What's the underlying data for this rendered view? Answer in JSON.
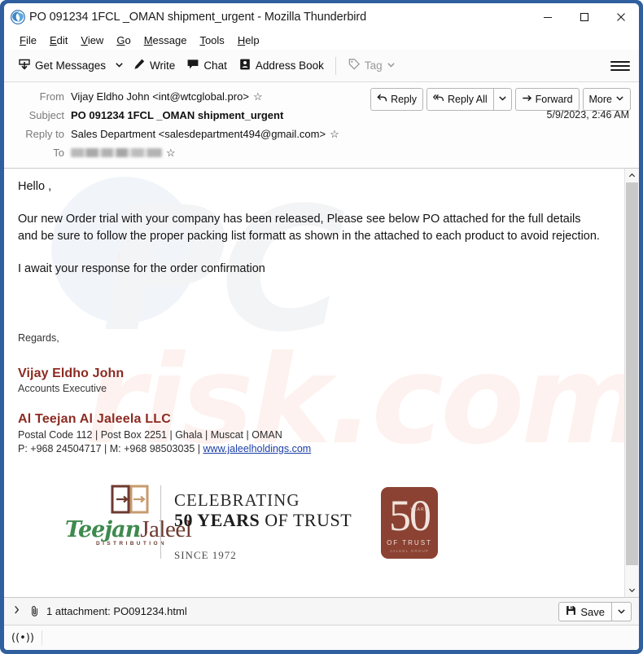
{
  "window": {
    "title": "PO 091234 1FCL _OMAN shipment_urgent - Mozilla Thunderbird",
    "app_icon": "thunderbird-icon",
    "controls": {
      "minimize": "–",
      "maximize": "□",
      "close": "✕"
    },
    "border_color": "#2f5f9e"
  },
  "menubar": {
    "items": [
      {
        "accel": "F",
        "rest": "ile"
      },
      {
        "accel": "E",
        "rest": "dit"
      },
      {
        "accel": "V",
        "rest": "iew"
      },
      {
        "accel": "G",
        "rest": "o"
      },
      {
        "accel": "M",
        "rest": "essage"
      },
      {
        "accel": "T",
        "rest": "ools"
      },
      {
        "accel": "H",
        "rest": "elp"
      }
    ]
  },
  "toolbar": {
    "get_messages": "Get Messages",
    "get_messages_icon": "inbox-download-icon",
    "get_messages_dropdown_icon": "chevron-down-icon",
    "write": "Write",
    "write_icon": "pencil-icon",
    "chat": "Chat",
    "chat_icon": "speech-bubble-icon",
    "address_book": "Address Book",
    "address_book_icon": "address-book-icon",
    "tag": "Tag",
    "tag_icon": "tag-icon",
    "tag_dropdown_icon": "chevron-down-icon",
    "menu_icon": "hamburger-menu-icon"
  },
  "message_header": {
    "from_label": "From",
    "from_value": "Vijay Eldho John <int@wtcglobal.pro>",
    "subject_label": "Subject",
    "subject_value": "PO 091234 1FCL _OMAN shipment_urgent",
    "reply_to_label": "Reply to",
    "reply_to_value": "Sales Department <salesdepartment494@gmail.com>",
    "to_label": "To",
    "to_value_redacted": true,
    "date": "5/9/2023, 2:46 AM",
    "star_icon": "star-outline-icon",
    "actions": {
      "reply": "Reply",
      "reply_icon": "reply-arrow-icon",
      "reply_all": "Reply All",
      "reply_all_icon": "reply-all-arrow-icon",
      "reply_all_dropdown_icon": "chevron-down-icon",
      "forward": "Forward",
      "forward_icon": "forward-arrow-icon",
      "more": "More",
      "more_dropdown_icon": "chevron-down-icon"
    }
  },
  "body": {
    "greeting": "Hello ,",
    "paragraph_1": "Our new Order trial with your company has been released, Please see below PO attached for the full details and be sure to follow the proper packing list formatt as shown in the attached to each product to avoid rejection.",
    "paragraph_2": "I await your response for the order confirmation",
    "watermark_text": "PCrisk.com",
    "signature": {
      "regards": "Regards,",
      "name": "Vijay Eldho John",
      "role": "Accounts Executive",
      "company": "Al Teejan Al Jaleela LLC",
      "address": "Postal Code 112 | Post Box 2251 | Ghala | Muscat | OMAN",
      "phone_prefix": "P: +968 24504717 | M: +968 98503035 | ",
      "website": "www.jaleelholdings.com",
      "accent_color": "#8c2b22",
      "link_color": "#1a3ea8"
    },
    "banner": {
      "brand_first": "Teejan",
      "brand_second": "Jaleel",
      "brand_tagline": "DISTRIBUTION",
      "celebrating_line1": "CELEBRATING",
      "celebrating_line2_bold": "50 YEARS",
      "celebrating_line2_rest": " OF TRUST",
      "since": "SINCE 1972",
      "badge_number": "50",
      "badge_years": "YEARS",
      "badge_trust": "OF TRUST",
      "badge_group": "JALEEL GROUP",
      "logo_icon": "teejan-jaleel-logo-icon",
      "badge_icon": "50-years-badge-icon",
      "green": "#3f8a4e",
      "brown": "#6d3a30",
      "badge_bg": "#8b4233"
    }
  },
  "scrollbar": {
    "up_icon": "chevron-up-icon",
    "down_icon": "chevron-down-icon"
  },
  "attachment_bar": {
    "expand_icon": "chevron-right-icon",
    "paperclip_icon": "paperclip-icon",
    "text": "1 attachment: PO091234.html",
    "save_label": "Save",
    "save_icon": "save-disk-icon",
    "save_dropdown_icon": "chevron-down-icon"
  },
  "status_bar": {
    "online_icon": "((•))",
    "online_icon_name": "connection-status-icon"
  }
}
